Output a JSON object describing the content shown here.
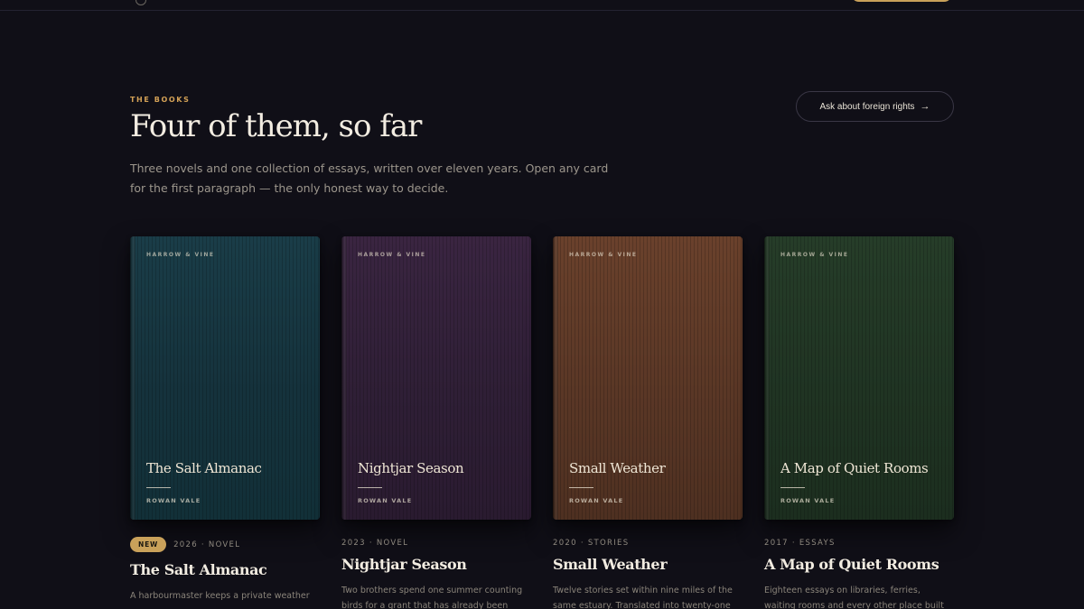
{
  "section": {
    "eyebrow": "THE BOOKS",
    "heading": "Four of them, so far",
    "intro": "Three novels and one collection of essays, written over eleven years. Open any card for the first paragraph — the only honest way to decide.",
    "rights_button": "Ask about foreign rights",
    "rights_icon": "arrow-right-icon"
  },
  "books": [
    {
      "publisher": "HARROW & VINE",
      "cover_title": "The Salt Almanac",
      "author": "ROWAN VALE",
      "badge": "NEW",
      "meta": "2026 · NOVEL",
      "title": "The Salt Almanac",
      "description": "A harbourmaster keeps a private weather",
      "cover_color": "#17343e"
    },
    {
      "publisher": "HARROW & VINE",
      "cover_title": "Nightjar Season",
      "author": "ROWAN VALE",
      "meta": "2023 · NOVEL",
      "title": "Nightjar Season",
      "description": "Two brothers spend one summer counting birds for a grant that has already been",
      "cover_color": "#34213a"
    },
    {
      "publisher": "HARROW & VINE",
      "cover_title": "Small Weather",
      "author": "ROWAN VALE",
      "meta": "2020 · STORIES",
      "title": "Small Weather",
      "description": "Twelve stories set within nine miles of the same estuary. Translated into twenty-one",
      "cover_color": "#5a3726"
    },
    {
      "publisher": "HARROW & VINE",
      "cover_title": "A Map of Quiet Rooms",
      "author": "ROWAN VALE",
      "meta": "2017 · ESSAYS",
      "title": "A Map of Quiet Rooms",
      "description": "Eighteen essays on libraries, ferries, waiting rooms and every other place built",
      "cover_color": "#213424"
    }
  ]
}
